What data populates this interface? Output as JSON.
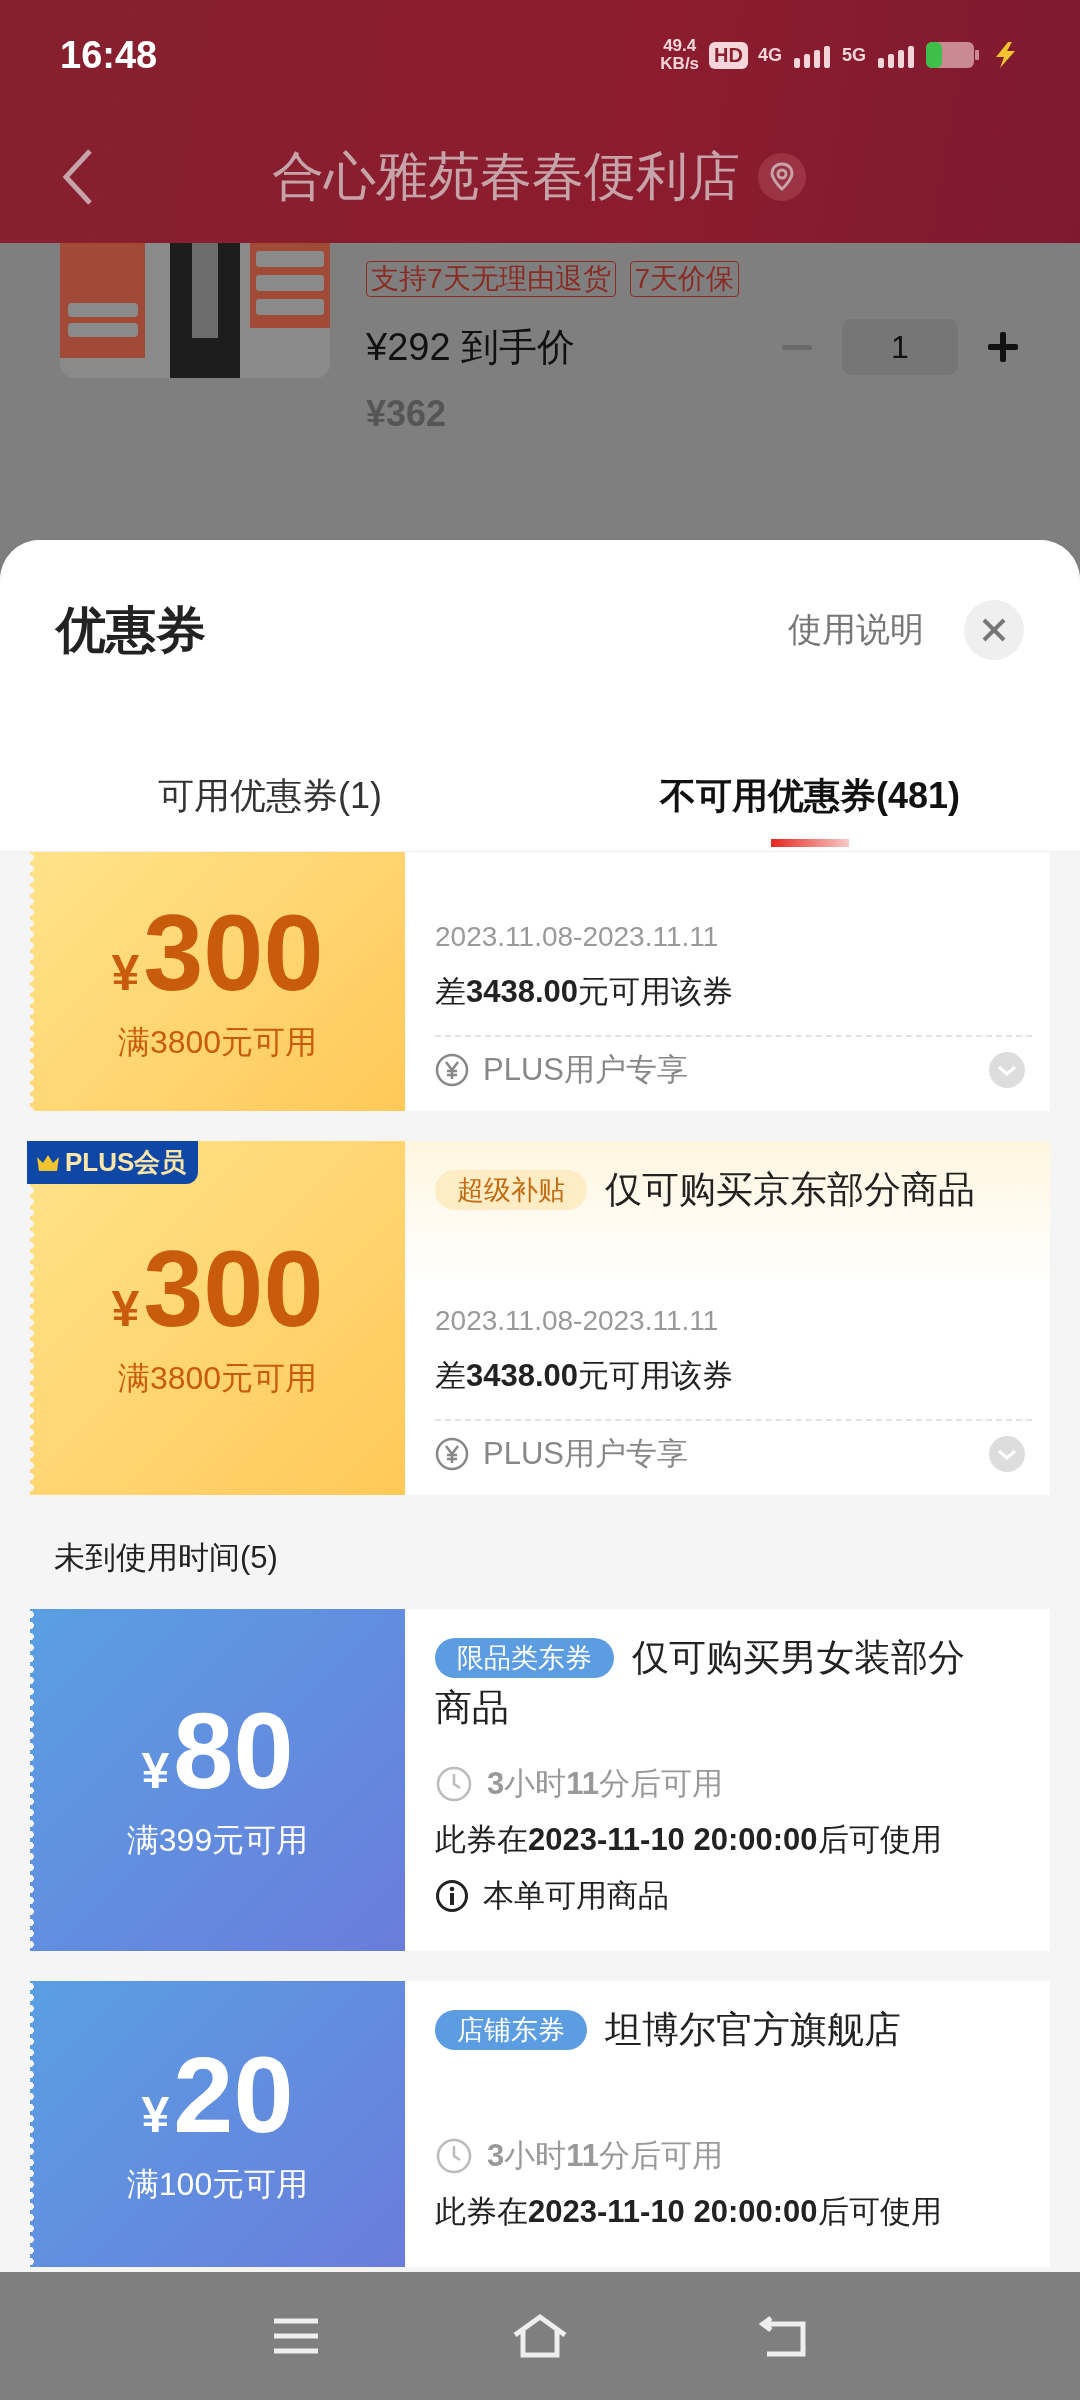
{
  "status_bar": {
    "time": "16:48",
    "speed": "49.4",
    "speed_unit": "KB/s",
    "hd": "HD",
    "net1": "4G",
    "net2": "5G"
  },
  "header": {
    "title": "合心雅苑春春便利店"
  },
  "product": {
    "tags": [
      "支持7天无理由退货",
      "7天价保"
    ],
    "price": "¥292 到手价",
    "original_price": "¥362",
    "quantity": "1"
  },
  "sheet": {
    "title": "优惠券",
    "help": "使用说明",
    "tabs": [
      {
        "label": "可用优惠券(1)",
        "selected": false
      },
      {
        "label": "不可用优惠券(481)",
        "selected": true
      }
    ],
    "groups": [
      {
        "coupons": [
          {
            "kind": "gold",
            "currency": "¥",
            "amount": "300",
            "condition": "满3800元可用",
            "date": "2023.11.08-2023.11.11",
            "need": "差**3438.00**元可用该券",
            "footer": "PLUS用户专享"
          },
          {
            "kind": "gold",
            "badge": "PLUS会员",
            "tag": "超级补贴",
            "title": "仅可购买京东部分商品",
            "currency": "¥",
            "amount": "300",
            "condition": "满3800元可用",
            "date": "2023.11.08-2023.11.11",
            "need": "差**3438.00**元可用该券",
            "footer": "PLUS用户专享"
          }
        ]
      },
      {
        "heading": "未到使用时间(5)",
        "coupons": [
          {
            "kind": "blue",
            "tag": "限品类东券",
            "title": "仅可购买男女装部分商品",
            "currency": "¥",
            "amount": "80",
            "condition": "满399元可用",
            "timer": "**3**小时**11**分后可用",
            "start": "此券在**2023-11-10 20:00:00**后可使用",
            "info": "本单可用商品"
          },
          {
            "kind": "blue",
            "tag": "店铺东券",
            "title": "坦博尔官方旗舰店",
            "currency": "¥",
            "amount": "20",
            "condition": "满100元可用",
            "timer": "**3**小时**11**分后可用",
            "start": "此券在**2023-11-10 20:00:00**后可使用"
          }
        ]
      }
    ]
  }
}
